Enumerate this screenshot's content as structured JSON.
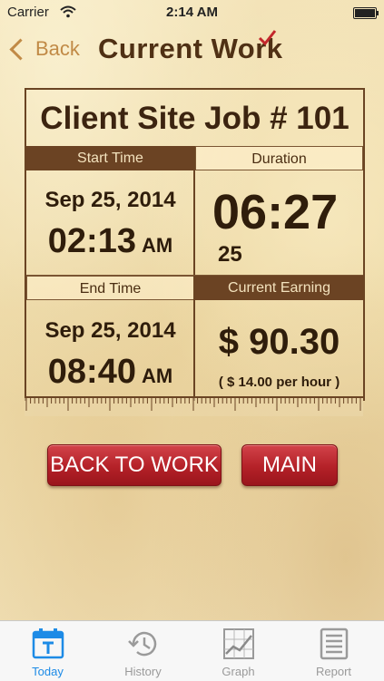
{
  "status_bar": {
    "carrier": "Carrier",
    "time": "2:14 AM"
  },
  "nav": {
    "back_label": "Back",
    "title": "Current Work"
  },
  "job": {
    "title": "Client Site Job # 101",
    "start_time": {
      "header": "Start Time",
      "date": "Sep 25, 2014",
      "time": "02:13",
      "ampm": "AM"
    },
    "duration": {
      "header": "Duration",
      "value": "06:27",
      "seconds": "25"
    },
    "end_time": {
      "header": "End Time",
      "date": "Sep 25, 2014",
      "time": "08:40",
      "ampm": "AM"
    },
    "current_earning": {
      "header": "Current Earning",
      "amount": "$ 90.30",
      "rate": "( $ 14.00 per hour )"
    }
  },
  "actions": {
    "back_to_work": "BACK TO WORK",
    "main": "MAIN"
  },
  "tabs": [
    {
      "label": "Today",
      "icon": "calendar-icon",
      "active": true
    },
    {
      "label": "History",
      "icon": "history-clock-icon",
      "active": false
    },
    {
      "label": "Graph",
      "icon": "graph-icon",
      "active": false
    },
    {
      "label": "Report",
      "icon": "report-icon",
      "active": false
    }
  ],
  "colors": {
    "accent_brown": "#6b4323",
    "button_red": "#b42128",
    "tab_active": "#1d8be6",
    "back_tint": "#c18a46"
  }
}
